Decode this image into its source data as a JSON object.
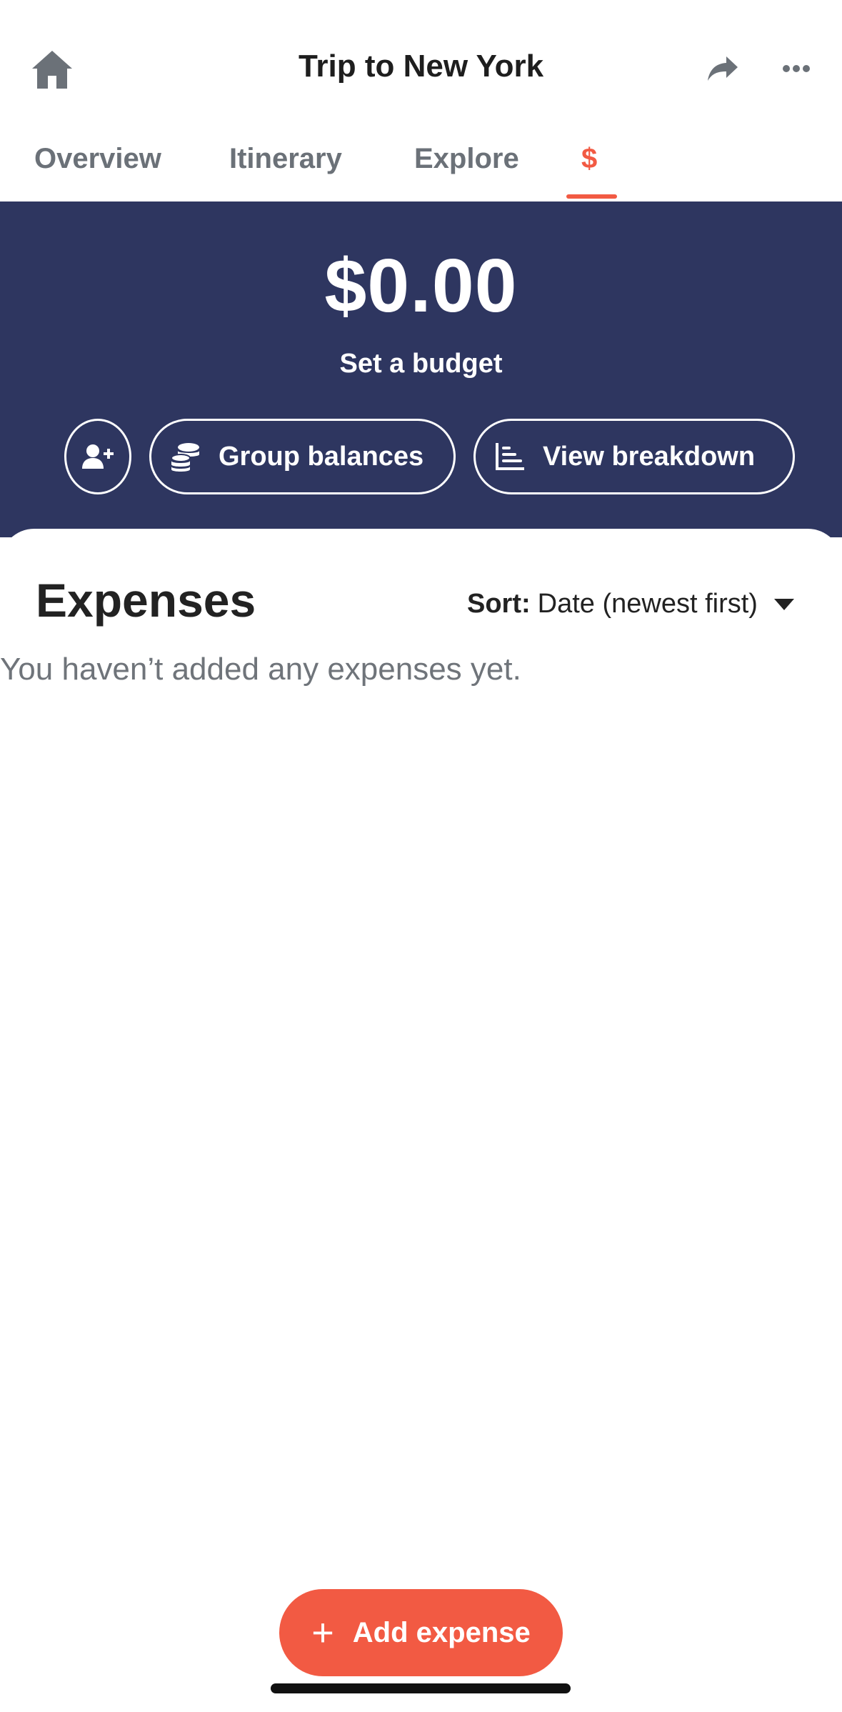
{
  "header": {
    "title": "Trip to New York",
    "icons": {
      "home": "home-icon",
      "share": "share-arrow-icon",
      "more": "more-dots-icon"
    }
  },
  "tabs": [
    {
      "label": "Overview",
      "active": false
    },
    {
      "label": "Itinerary",
      "active": false
    },
    {
      "label": "Explore",
      "active": false
    },
    {
      "label": "$",
      "active": true
    }
  ],
  "summary": {
    "amount": "$0.00",
    "set_budget_label": "Set a budget",
    "group_balances_label": "Group balances",
    "view_breakdown_label": "View breakdown",
    "icons": {
      "add_person": "add-person-icon",
      "coins": "coins-icon",
      "chart": "bar-chart-icon"
    }
  },
  "expenses": {
    "heading": "Expenses",
    "sort_label": "Sort:",
    "sort_value": "Date (newest first)",
    "empty_message": "You haven’t added any expenses yet."
  },
  "fab": {
    "label": "Add expense"
  },
  "colors": {
    "accent": "#f25a43",
    "summary_bg": "#2e3660",
    "tab_inactive": "#6b7178",
    "empty_text": "#6f747a"
  }
}
